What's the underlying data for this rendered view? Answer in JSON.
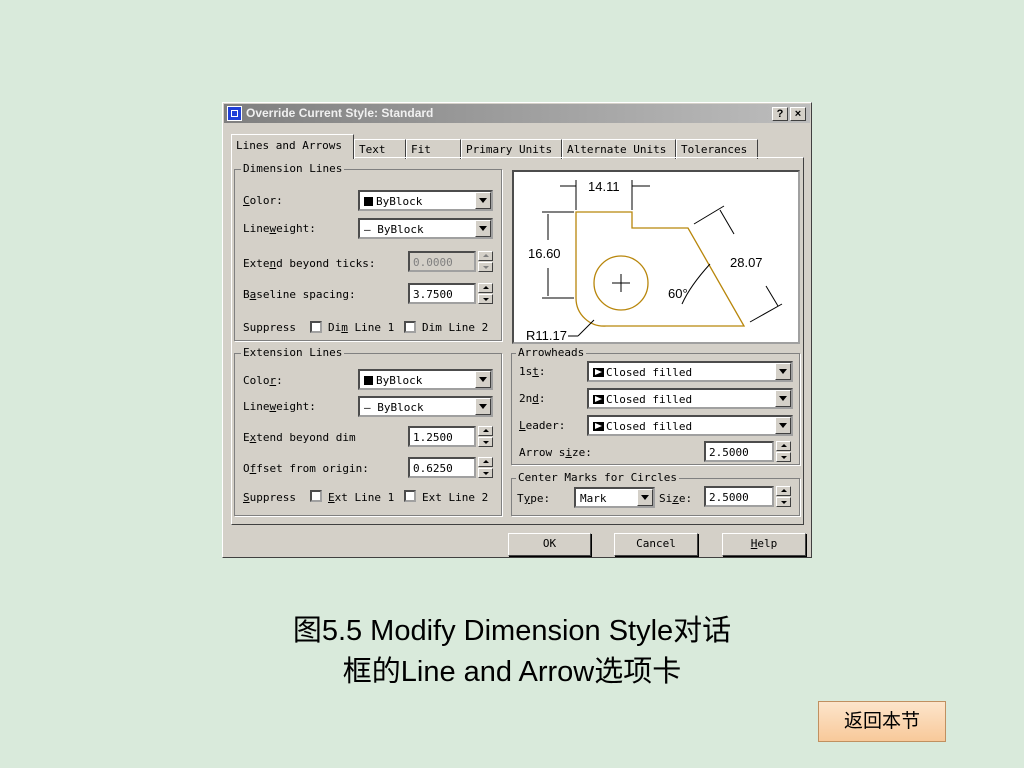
{
  "dialog": {
    "title": "Override Current Style: Standard",
    "help_glyph": "?",
    "close_glyph": "×",
    "tabs": [
      "Lines and Arrows",
      "Text",
      "Fit",
      "Primary Units",
      "Alternate Units",
      "Tolerances"
    ],
    "dimension_lines": {
      "legend": "Dimension Lines",
      "color_label": "Color:",
      "color_value": "ByBlock",
      "lineweight_label": "Lineweight:",
      "lineweight_value": "— ByBlock",
      "extend_label": "Extend beyond ticks:",
      "extend_value": "0.0000",
      "baseline_label": "Baseline spacing:",
      "baseline_value": "3.7500",
      "suppress_label": "Suppress",
      "dim_line1": "Dim Line 1",
      "dim_line2": "Dim Line 2"
    },
    "extension_lines": {
      "legend": "Extension Lines",
      "color_label": "Color:",
      "color_value": "ByBlock",
      "lineweight_label": "Lineweight:",
      "lineweight_value": "— ByBlock",
      "extend_label": "Extend beyond dim",
      "extend_value": "1.2500",
      "offset_label": "Offset from origin:",
      "offset_value": "0.6250",
      "suppress_label": "Suppress",
      "ext_line1": "Ext Line 1",
      "ext_line2": "Ext Line 2"
    },
    "preview": {
      "dim_top": "14.11",
      "dim_left": "16.60",
      "dim_right": "28.07",
      "dim_angle": "60°",
      "dim_radius": "R11.17"
    },
    "arrowheads": {
      "legend": "Arrowheads",
      "first_label": "1st:",
      "first_value": "Closed filled",
      "second_label": "2nd:",
      "second_value": "Closed filled",
      "leader_label": "Leader:",
      "leader_value": "Closed filled",
      "size_label": "Arrow size:",
      "size_value": "2.5000"
    },
    "center_marks": {
      "legend": "Center Marks for Circles",
      "type_label": "Type:",
      "type_value": "Mark",
      "size_label": "Size:",
      "size_value": "2.5000"
    },
    "buttons": {
      "ok": "OK",
      "cancel": "Cancel",
      "help": "Help"
    }
  },
  "caption": {
    "line1": "图5.5  Modify Dimension Style对话",
    "line2": "框的Line and Arrow选项卡"
  },
  "back_button": "返回本节",
  "colors": {
    "background": "#d9eadb",
    "dialog": "#d4d0c8",
    "drawing": "#b8860b"
  }
}
